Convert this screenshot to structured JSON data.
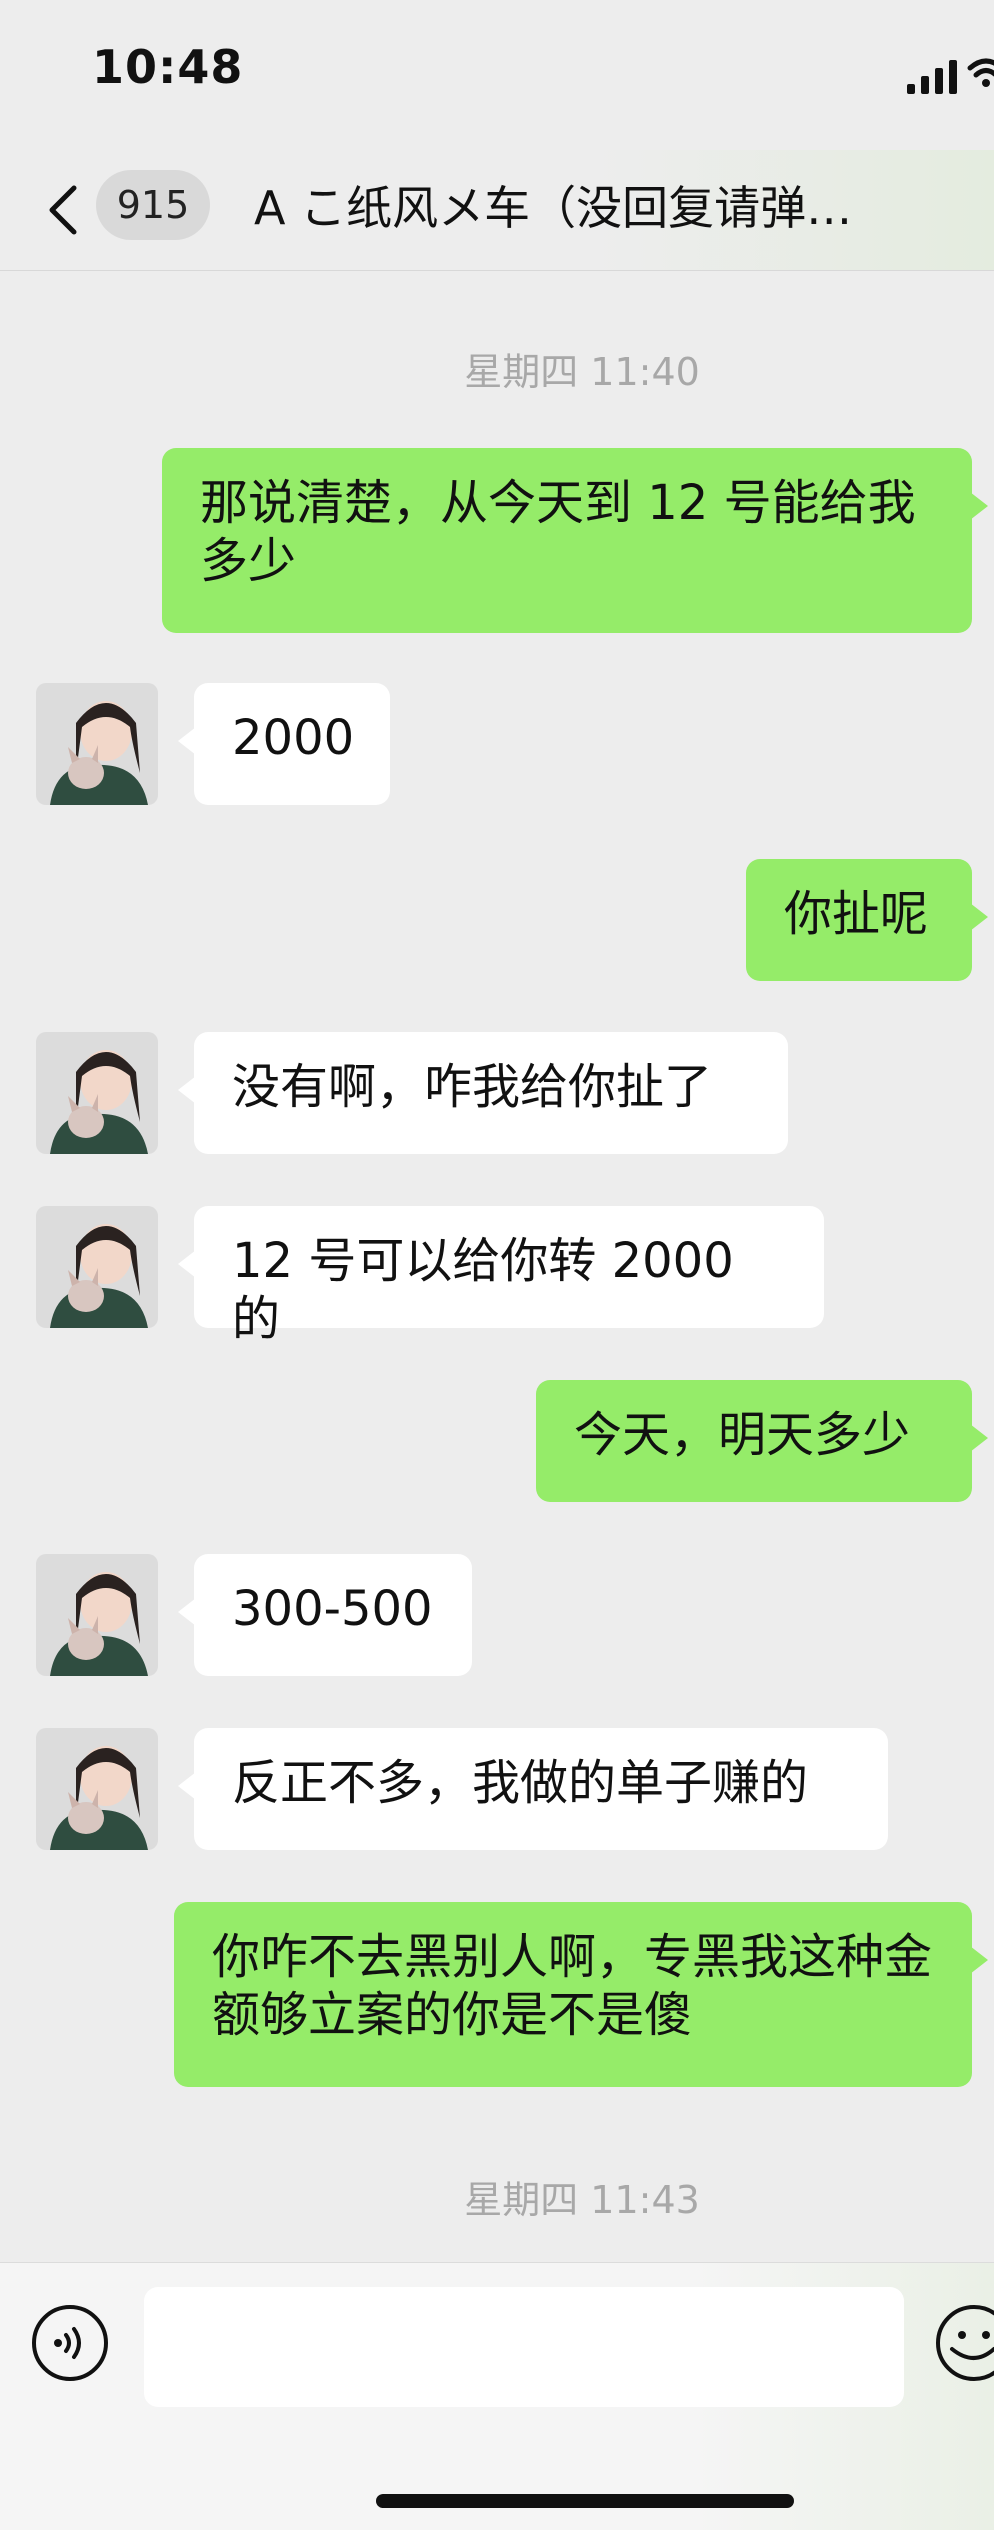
{
  "status_bar": {
    "time": "10:48"
  },
  "nav": {
    "unread_count": "915",
    "title": "A こ纸风メ车（没回复请弹…"
  },
  "messages": [
    {
      "type": "timestamp",
      "text": "星期四 11:40"
    },
    {
      "type": "mine",
      "text": "那说清楚，从今天到 12 号能给我多少"
    },
    {
      "type": "theirs",
      "text": "2000"
    },
    {
      "type": "mine",
      "text": "你扯呢"
    },
    {
      "type": "theirs",
      "text": "没有啊，咋我给你扯了"
    },
    {
      "type": "theirs",
      "text": "12 号可以给你转 2000 的"
    },
    {
      "type": "mine",
      "text": "今天，明天多少"
    },
    {
      "type": "theirs",
      "text": "300-500"
    },
    {
      "type": "theirs",
      "text": "反正不多，我做的单子赚的"
    },
    {
      "type": "mine",
      "text": "你咋不去黑别人啊，专黑我这种金额够立案的你是不是傻"
    },
    {
      "type": "timestamp",
      "text": "星期四 11:43"
    }
  ],
  "input": {
    "value": "",
    "placeholder": ""
  },
  "icons": {
    "back": "chevron-left-icon",
    "voice": "voice-icon",
    "emoji": "emoji-icon",
    "signal": "signal-bars-icon",
    "wifi": "wifi-icon",
    "avatar": "contact-avatar"
  },
  "colors": {
    "my_bubble": "#95ec69",
    "their_bubble": "#ffffff",
    "chat_background": "#ededed",
    "timestamp_text": "#a8a8a8"
  }
}
